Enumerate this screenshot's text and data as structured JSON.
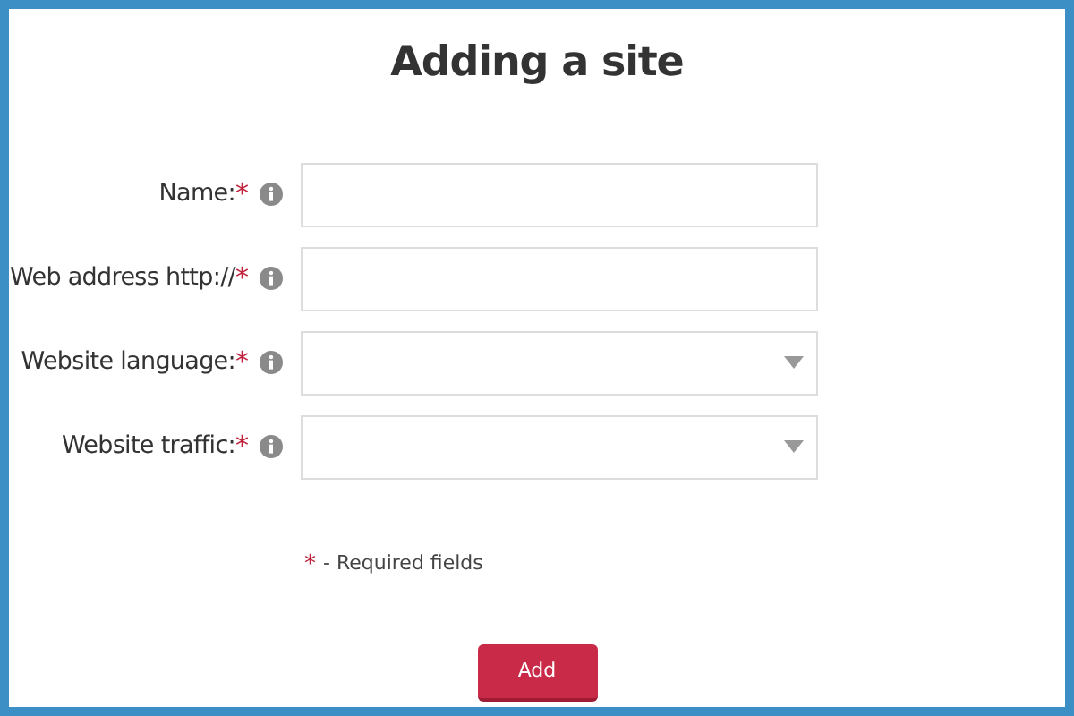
{
  "title": "Adding a site",
  "fields": [
    {
      "label": "Name:",
      "required_mark": "*",
      "kind": "text"
    },
    {
      "label": "Web address http://",
      "required_mark": "*",
      "kind": "text"
    },
    {
      "label": "Website language:",
      "required_mark": "*",
      "kind": "select"
    },
    {
      "label": "Website traffic:",
      "required_mark": "*",
      "kind": "select"
    }
  ],
  "required_note": {
    "mark": "*",
    "text": "- Required fields"
  },
  "buttons": [
    "Add"
  ]
}
